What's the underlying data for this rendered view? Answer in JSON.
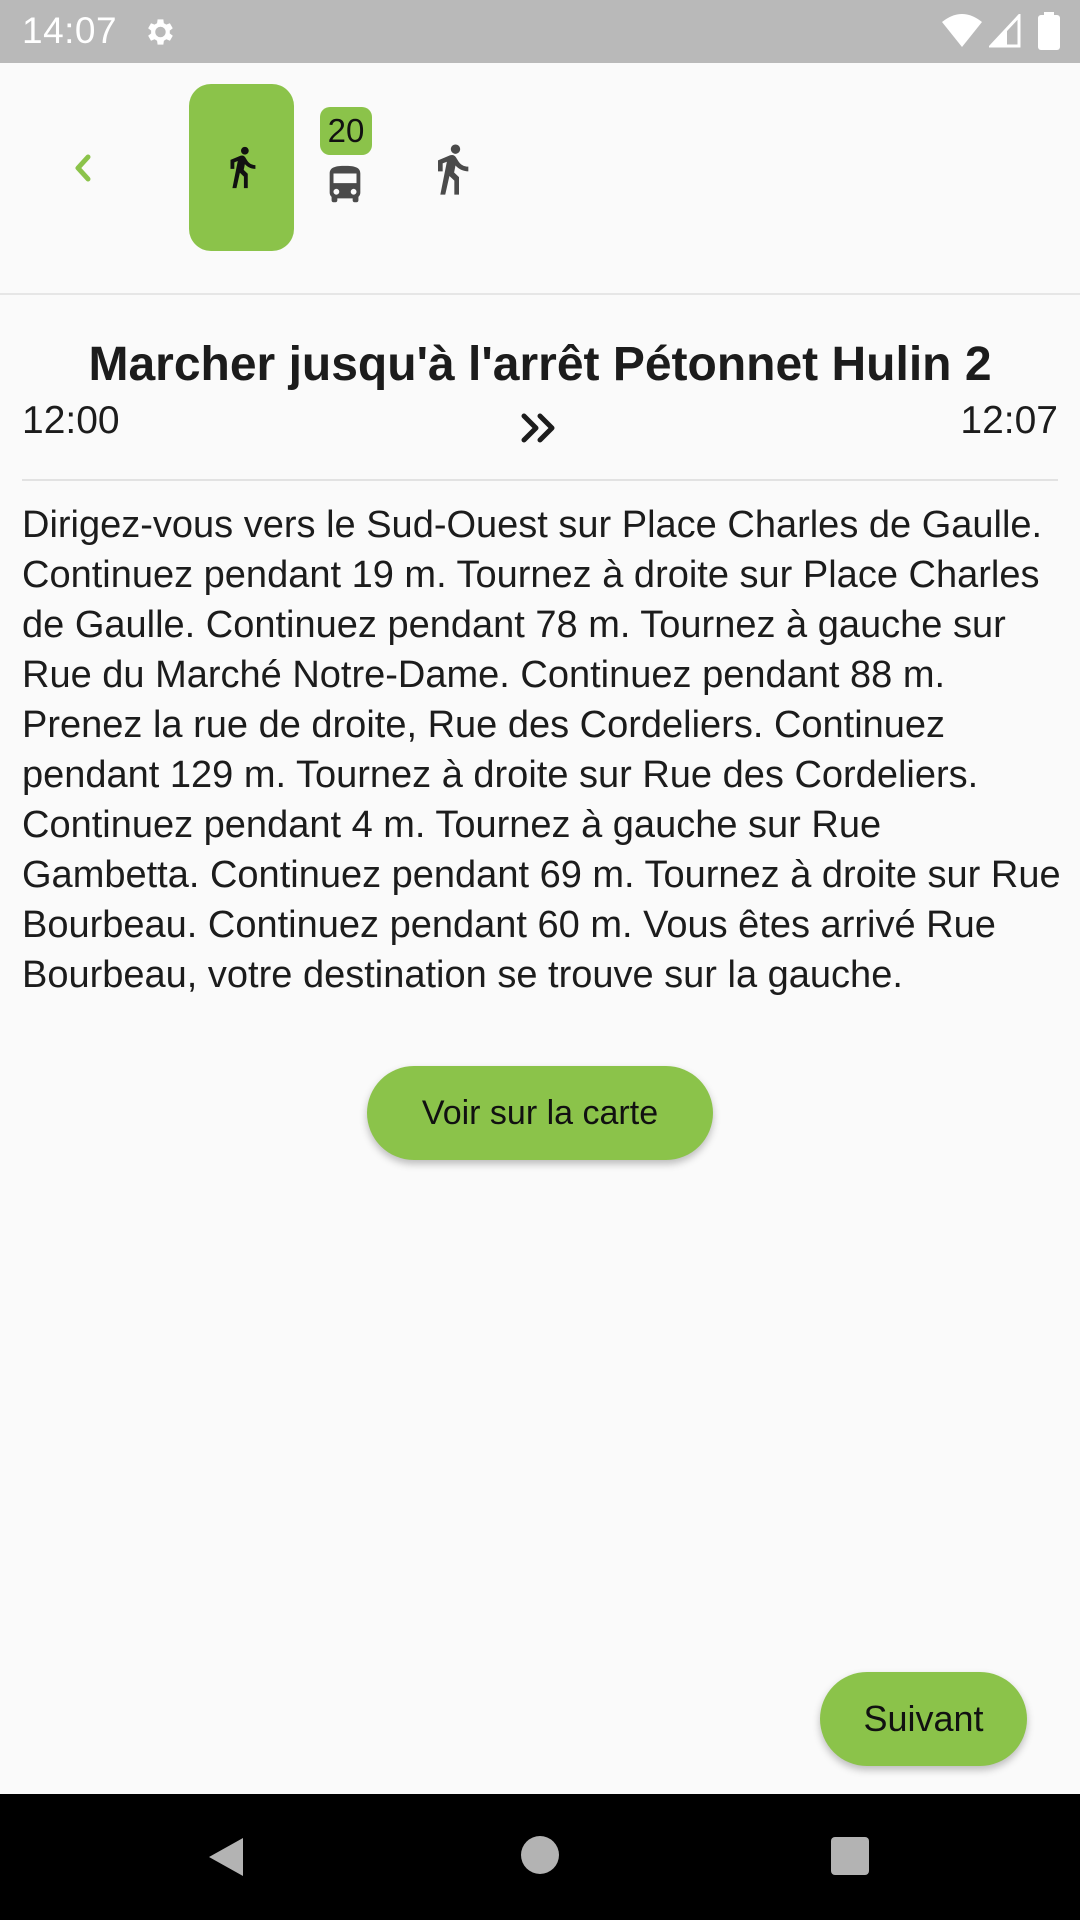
{
  "status_bar": {
    "time": "14:07",
    "icons": [
      "gear-icon",
      "wifi-icon",
      "signal-icon",
      "battery-icon"
    ]
  },
  "header": {
    "back_icon": "chevron-left-icon",
    "steps": [
      {
        "type": "walk",
        "icon": "walk-icon",
        "active": true
      },
      {
        "type": "bus",
        "icon": "bus-icon",
        "line": "20",
        "active": false
      },
      {
        "type": "walk",
        "icon": "walk-icon",
        "active": false
      }
    ]
  },
  "step": {
    "title": "Marcher jusqu'à l'arrêt Pétonnet Hulin 2",
    "start_time": "12:00",
    "end_time": "12:07",
    "instructions": "Dirigez-vous vers le Sud-Ouest sur Place Charles de Gaulle. Continuez pendant 19 m. Tournez à droite sur Place Charles de Gaulle. Continuez pendant 78 m. Tournez à gauche sur Rue du Marché Notre-Dame. Continuez pendant 88 m. Prenez la rue de droite, Rue des Cordeliers. Continuez pendant 129 m. Tournez à droite sur Rue des Cordeliers. Continuez pendant 4 m. Tournez à gauche sur Rue Gambetta. Continuez pendant 69 m. Tournez à droite sur Rue Bourbeau. Continuez pendant 60 m. Vous êtes arrivé Rue Bourbeau, votre destination se trouve sur la gauche.",
    "map_button_label": "Voir sur la carte"
  },
  "footer": {
    "next_button_label": "Suivant"
  },
  "colors": {
    "accent": "#8bc34a",
    "status_bar": "#b9b9b9",
    "background": "#fafafa"
  }
}
